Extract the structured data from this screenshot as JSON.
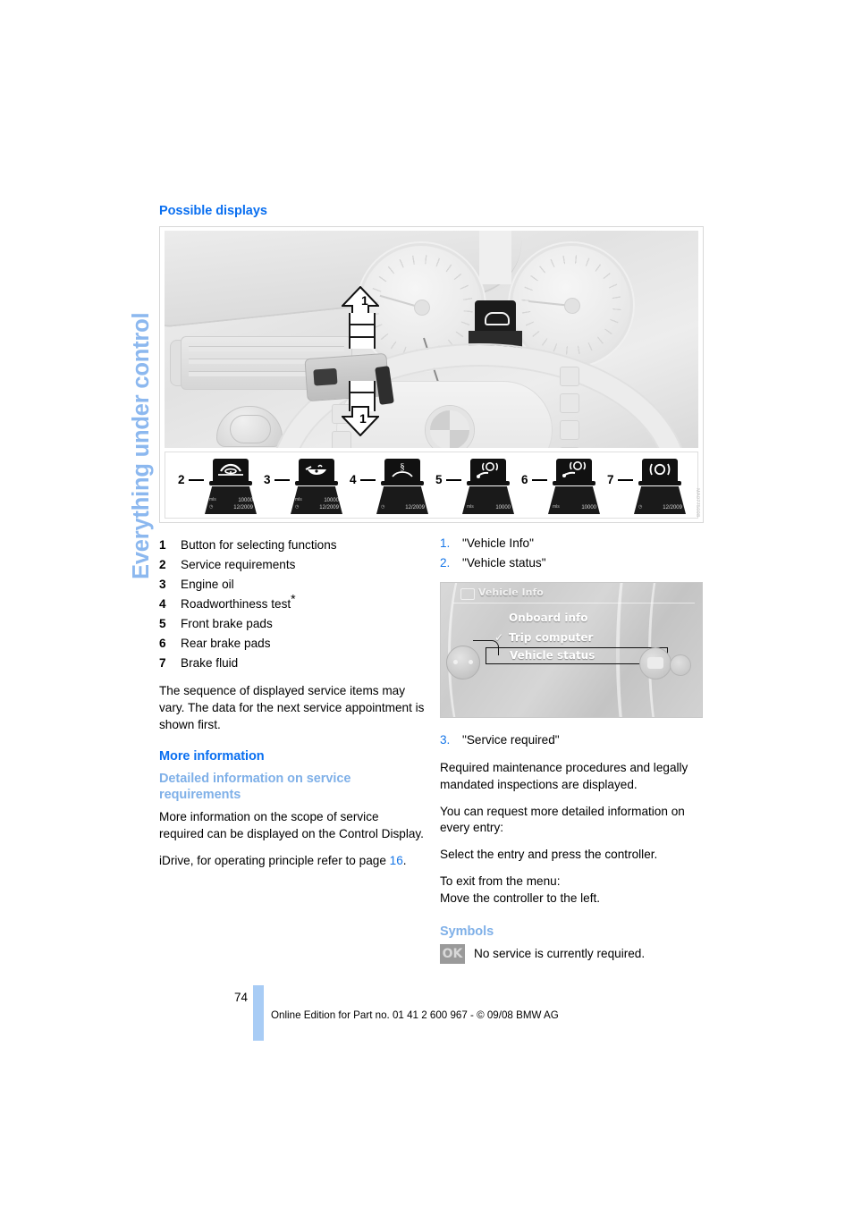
{
  "chapter_tab": "Everything under control",
  "page_number": "74",
  "footer_note": "Online Edition for Part no. 01 41 2 600 967  - © 09/08 BMW AG",
  "left_column": {
    "heading": "Possible displays",
    "figure": {
      "callout_arrow_label": "1",
      "figure_code": "MA0775008",
      "icons": [
        {
          "num": "2",
          "glyph": "service-requirements-icon",
          "unit_label": "mls",
          "distance": "10000",
          "date": "12/2009",
          "show_distance": true,
          "show_date": true
        },
        {
          "num": "3",
          "glyph": "engine-oil-icon",
          "unit_label": "mls",
          "distance": "10000",
          "date": "12/2009",
          "show_distance": true,
          "show_date": true
        },
        {
          "num": "4",
          "glyph": "roadworthiness-test-icon",
          "unit_label": "",
          "distance": "",
          "date": "12/2009",
          "show_distance": false,
          "show_date": true
        },
        {
          "num": "5",
          "glyph": "front-brake-pads-icon",
          "unit_label": "mls",
          "distance": "10000",
          "date": "",
          "show_distance": true,
          "show_date": false
        },
        {
          "num": "6",
          "glyph": "rear-brake-pads-icon",
          "unit_label": "mls",
          "distance": "10000",
          "date": "",
          "show_distance": true,
          "show_date": false
        },
        {
          "num": "7",
          "glyph": "brake-fluid-icon",
          "unit_label": "",
          "distance": "",
          "date": "12/2009",
          "show_distance": false,
          "show_date": true
        }
      ]
    },
    "legend": [
      {
        "key": "1",
        "label": "Button for selecting functions",
        "asterisk": false
      },
      {
        "key": "2",
        "label": "Service requirements",
        "asterisk": false
      },
      {
        "key": "3",
        "label": "Engine oil",
        "asterisk": false
      },
      {
        "key": "4",
        "label": "Roadworthiness test",
        "asterisk": true
      },
      {
        "key": "5",
        "label": "Front brake pads",
        "asterisk": false
      },
      {
        "key": "6",
        "label": "Rear brake pads",
        "asterisk": false
      },
      {
        "key": "7",
        "label": "Brake fluid",
        "asterisk": false
      }
    ],
    "note": "The sequence of displayed service items may vary. The data for the next service appointment is shown first.",
    "more_information_heading": "More information",
    "detailed_info_heading": "Detailed information on service requirements",
    "detailed_info_body": "More information on the scope of service required can be displayed on the Control Display.",
    "idrive_ref_prefix": "iDrive, for operating principle refer to page ",
    "idrive_ref_page": "16",
    "idrive_ref_suffix": "."
  },
  "right_column": {
    "steps_top": [
      {
        "key": "1.",
        "label": "\"Vehicle Info\""
      },
      {
        "key": "2.",
        "label": "\"Vehicle status\""
      }
    ],
    "idrive_screen": {
      "title": "Vehicle Info",
      "title_icon": "vehicle-info-icon",
      "items": [
        {
          "label": "Onboard info",
          "checked": false,
          "selected": false
        },
        {
          "label": "Trip computer",
          "checked": true,
          "selected": false
        },
        {
          "label": "Vehicle status",
          "checked": false,
          "selected": true
        }
      ]
    },
    "step_three": {
      "key": "3.",
      "label": "\"Service required\""
    },
    "paragraphs": [
      "Required maintenance procedures and legally mandated inspections are displayed.",
      "You can request more detailed information on every entry:",
      "Select the entry and press the controller."
    ],
    "exit_line_1": "To exit from the menu:",
    "exit_line_2": "Move the controller to the left.",
    "symbols_heading": "Symbols",
    "symbols": [
      {
        "badge": "OK",
        "text": "No service is currently required."
      }
    ]
  },
  "colors": {
    "heading_blue": "#0a6ff0",
    "subheading_blue": "#7fb0e8",
    "tab_blue": "#8cb8ef",
    "link_blue": "#1676e8",
    "footer_bar_blue": "#a8ccf5"
  }
}
